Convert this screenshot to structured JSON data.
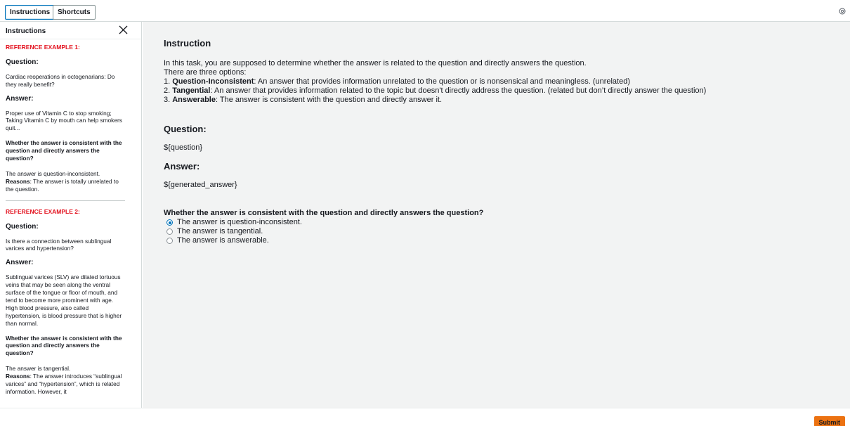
{
  "toolbar": {
    "instructions_label": "Instructions",
    "shortcuts_label": "Shortcuts",
    "settings_icon": "settings-icon"
  },
  "sidebar": {
    "title": "Instructions",
    "close_icon": "close-icon",
    "examples": [
      {
        "label": "REFERENCE EXAMPLE 1:",
        "question_heading": "Question:",
        "question": "Cardiac reoperations in octogenarians: Do they really benefit?",
        "answer_heading": "Answer:",
        "answer": "Proper use of Vitamin C to stop smoking; Taking Vitamin C by mouth can help smokers quit...",
        "prompt": "Whether the answer is consistent with the question and directly answers the question?",
        "verdict": "The answer is question-inconsistent.",
        "reasons_label": "Reasons",
        "reasons_text": ": The answer is totally unrelated to the question."
      },
      {
        "label": "REFERENCE EXAMPLE 2:",
        "question_heading": "Question:",
        "question": "Is there a connection between sublingual varices and hypertension?",
        "answer_heading": "Answer:",
        "answer": "Sublingual varices (SLV) are dilated tortuous veins that may be seen along the ventral surface of the tongue or floor of mouth, and tend to become more prominent with age. High blood pressure, also called hypertension, is blood pressure that is higher than normal.",
        "prompt": "Whether the answer is consistent with the question and directly answers the question?",
        "verdict": "The answer is tangential.",
        "reasons_label": "Reasons",
        "reasons_text": ": The answer introduces “sublingual varices” and “hypertension”, which is related information. However, it"
      }
    ]
  },
  "main": {
    "title": "Instruction",
    "intro": "In this task, you are supposed to determine whether the answer is related to the question and directly answers the question.",
    "options_intro": "There are three options:",
    "options": [
      {
        "num": "1. ",
        "term": "Question-Inconsistent",
        "desc": ": An answer that provides information unrelated to the question or is nonsensical and meaningless. (unrelated)"
      },
      {
        "num": "2. ",
        "term": "Tangential",
        "desc": ": An answer that provides information related to the topic but doesn't directly address the question. (related but don’t directly answer the question)"
      },
      {
        "num": "3. ",
        "term": "Answerable",
        "desc": ": The answer is consistent with the question and directly answer it."
      }
    ],
    "question_heading": "Question:",
    "question_value": "${question}",
    "answer_heading": "Answer:",
    "answer_value": "${generated_answer}",
    "prompt": "Whether the answer is consistent with the question and directly answers the question?",
    "choices": [
      {
        "label": "The answer is question-inconsistent.",
        "checked": true
      },
      {
        "label": "The answer is tangential.",
        "checked": false
      },
      {
        "label": "The answer is answerable.",
        "checked": false
      }
    ]
  },
  "footer": {
    "submit_label": "Submit"
  },
  "colors": {
    "accent": "#0073bb",
    "reference_red": "#e3111e",
    "submit_orange": "#ec7211",
    "main_background": "#f2f3f3"
  }
}
